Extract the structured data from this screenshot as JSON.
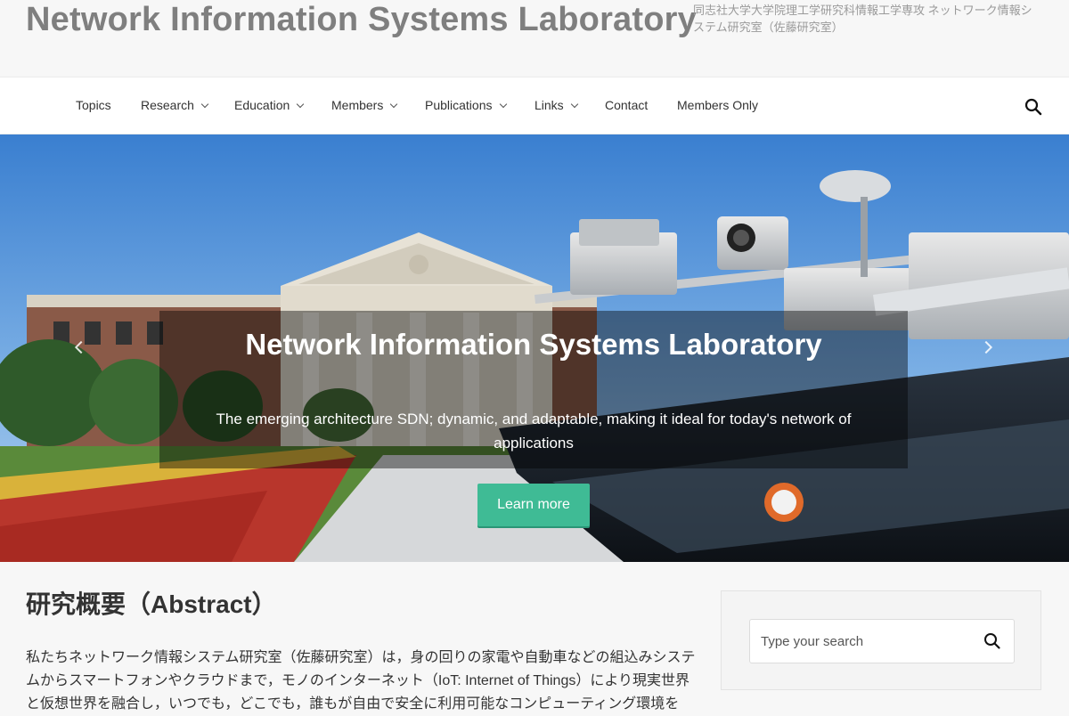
{
  "header": {
    "site_title": "Network Information Systems Laboratory",
    "tagline": "同志社大学大学院理工学研究科情報工学専攻 ネットワーク情報システム研究室（佐藤研究室）"
  },
  "nav": {
    "items": [
      {
        "label": "Topics",
        "has_dropdown": false
      },
      {
        "label": "Research",
        "has_dropdown": true
      },
      {
        "label": "Education",
        "has_dropdown": true
      },
      {
        "label": "Members",
        "has_dropdown": true
      },
      {
        "label": "Publications",
        "has_dropdown": true
      },
      {
        "label": "Links",
        "has_dropdown": true
      },
      {
        "label": "Contact",
        "has_dropdown": false
      },
      {
        "label": "Members Only",
        "has_dropdown": false
      }
    ],
    "search_icon": "search-icon"
  },
  "hero": {
    "title": "Network Information Systems Laboratory",
    "subtitle": "The emerging architecture SDN; dynamic, and adaptable, making it ideal for today's network of applications",
    "button_label": "Learn more",
    "button_color": "#3fbb95"
  },
  "main": {
    "heading_ja": "研究概要（",
    "heading_en": "Abstract",
    "heading_close": "）",
    "paragraph": "私たちネットワーク情報システム研究室（佐藤研究室）は，身の回りの家電や自動車などの組込みシステムからスマートフォンやクラウドまで，モノのインターネット（IoT: Internet of Things）により現実世界と仮想世界を融合し，いつでも，どこでも，誰もが自由で安全に利用可能なコンピューティング環境を"
  },
  "sidebar": {
    "search_placeholder": "Type your search"
  }
}
